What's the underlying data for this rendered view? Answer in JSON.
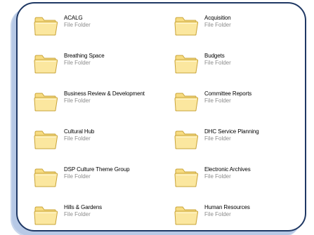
{
  "folders": [
    {
      "name": "ACALG",
      "type": "File Folder",
      "icon": "folder-icon"
    },
    {
      "name": "Acquisition",
      "type": "File Folder",
      "icon": "folder-icon"
    },
    {
      "name": "Breathing Space",
      "type": "File Folder",
      "icon": "folder-icon"
    },
    {
      "name": "Budgets",
      "type": "File Folder",
      "icon": "folder-icon"
    },
    {
      "name": "Business Review & Development",
      "type": "File Folder",
      "icon": "folder-icon"
    },
    {
      "name": "Committee Reports",
      "type": "File Folder",
      "icon": "folder-icon"
    },
    {
      "name": "Cultural Hub",
      "type": "File Folder",
      "icon": "folder-icon"
    },
    {
      "name": "DHC Service Planning",
      "type": "File Folder",
      "icon": "folder-icon"
    },
    {
      "name": "DSP Culture Theme Group",
      "type": "File Folder",
      "icon": "folder-icon"
    },
    {
      "name": "Electronic Archives",
      "type": "File Folder",
      "icon": "folder-icon"
    },
    {
      "name": "Hills & Gardens",
      "type": "File Folder",
      "icon": "folder-icon"
    },
    {
      "name": "Human Resources",
      "type": "File Folder",
      "icon": "folder-icon"
    }
  ],
  "colors": {
    "frame_border": "#1f3864",
    "frame_shadow": "#b7c9e6",
    "folder_fill": "#f7dc82",
    "folder_edge": "#c9a43a",
    "type_text": "#8c8c8c"
  }
}
